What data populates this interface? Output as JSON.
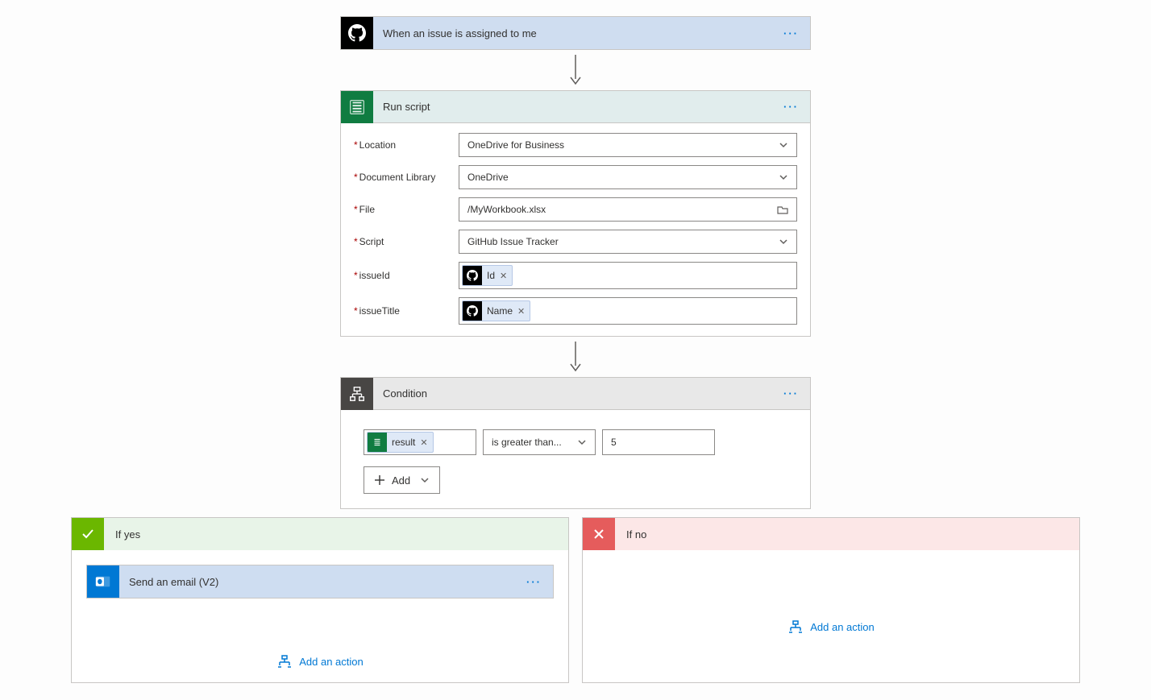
{
  "trigger": {
    "title": "When an issue is assigned to me"
  },
  "runScript": {
    "title": "Run script",
    "fields": {
      "location": {
        "label": "Location",
        "value": "OneDrive for Business"
      },
      "documentLibrary": {
        "label": "Document Library",
        "value": "OneDrive"
      },
      "file": {
        "label": "File",
        "value": "/MyWorkbook.xlsx"
      },
      "script": {
        "label": "Script",
        "value": "GitHub Issue Tracker"
      },
      "issueId": {
        "label": "issueId",
        "token": "Id"
      },
      "issueTitle": {
        "label": "issueTitle",
        "token": "Name"
      }
    }
  },
  "condition": {
    "title": "Condition",
    "leftToken": "result",
    "operator": "is greater than...",
    "rightValue": "5",
    "addLabel": "Add"
  },
  "branches": {
    "yes": {
      "title": "If yes",
      "action": {
        "title": "Send an email (V2)"
      },
      "addActionLabel": "Add an action"
    },
    "no": {
      "title": "If no",
      "addActionLabel": "Add an action"
    }
  }
}
